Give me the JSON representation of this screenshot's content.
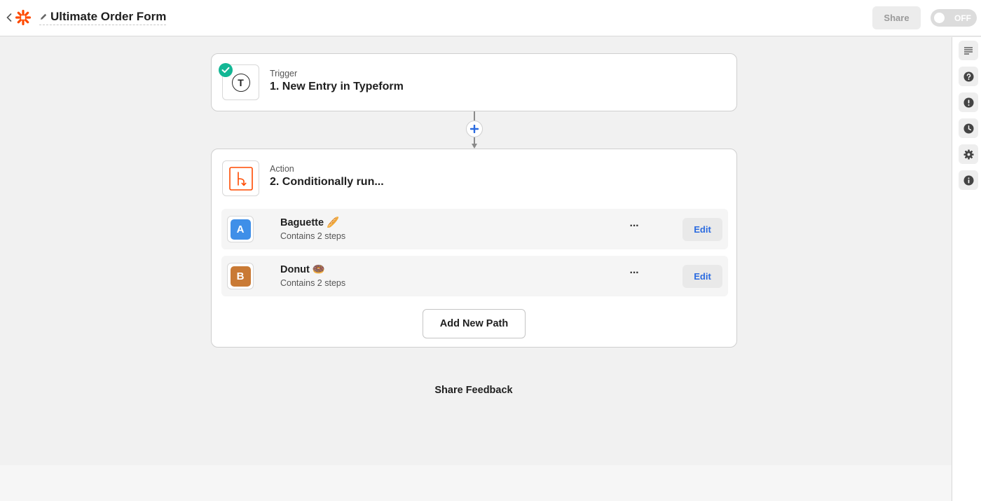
{
  "header": {
    "title": "Ultimate Order Form",
    "share_label": "Share",
    "toggle_label": "OFF"
  },
  "colors": {
    "brand": "#ff4a00",
    "success": "#13b795",
    "link": "#2b6be0",
    "path_a": "#3f8fe8",
    "path_b": "#c97a35"
  },
  "sidebar": {
    "items": [
      {
        "icon": "details-icon"
      },
      {
        "icon": "help-icon"
      },
      {
        "icon": "alert-icon"
      },
      {
        "icon": "history-icon"
      },
      {
        "icon": "settings-icon"
      },
      {
        "icon": "info-icon"
      }
    ]
  },
  "trigger": {
    "label": "Trigger",
    "title": "1. New Entry in Typeform",
    "app_letter": "T"
  },
  "action": {
    "label": "Action",
    "title": "2. Conditionally run...",
    "paths": [
      {
        "letter": "A",
        "name": "Baguette",
        "emoji": "🥖",
        "subtitle": "Contains 2 steps",
        "menu": "···",
        "edit_label": "Edit"
      },
      {
        "letter": "B",
        "name": "Donut",
        "emoji": "🍩",
        "subtitle": "Contains 2 steps",
        "menu": "···",
        "edit_label": "Edit"
      }
    ],
    "add_path_label": "Add New Path"
  },
  "footer": {
    "feedback_label": "Share Feedback"
  }
}
